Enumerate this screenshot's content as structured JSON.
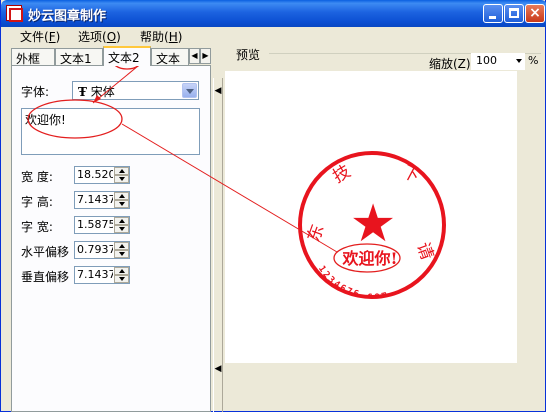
{
  "window": {
    "title": "妙云图章制作"
  },
  "menu": [
    {
      "label": "文件(",
      "key": "F",
      "end": ")"
    },
    {
      "label": "选项(",
      "key": "O",
      "end": ")"
    },
    {
      "label": "帮助(",
      "key": "H",
      "end": ")"
    }
  ],
  "tabs": [
    "外框",
    "文本1",
    "文本2",
    "文本"
  ],
  "active_tab": "文本2",
  "form": {
    "font_label": "字体:",
    "font_value": "宋体",
    "font_icon": "Ŧ",
    "text_value": "欢迎你!",
    "fields": [
      {
        "label": "宽  度:",
        "value": "18.520"
      },
      {
        "label": "字  高:",
        "value": "7.1437"
      },
      {
        "label": "字  宽:",
        "value": "1.5875"
      },
      {
        "label": "水平偏移",
        "value": "0.7937"
      },
      {
        "label": "垂直偏移",
        "value": "7.1437"
      }
    ]
  },
  "preview": {
    "label": "预览",
    "zoom_label": "缩放(Z)",
    "zoom_value": "100",
    "zoom_unit": "%"
  },
  "stamp": {
    "top_text": [
      "技",
      "下"
    ],
    "left_text": "东",
    "right_text": "请",
    "center_text": "欢迎你!",
    "bottom_text": "1234676.com",
    "star": "★",
    "color": "#e8141e"
  },
  "colors": {
    "titlebar": "#0c4fd3",
    "stamp_red": "#e8141e",
    "annotation_red": "#e31e1e",
    "active_tab_accent": "#ffc83c"
  }
}
